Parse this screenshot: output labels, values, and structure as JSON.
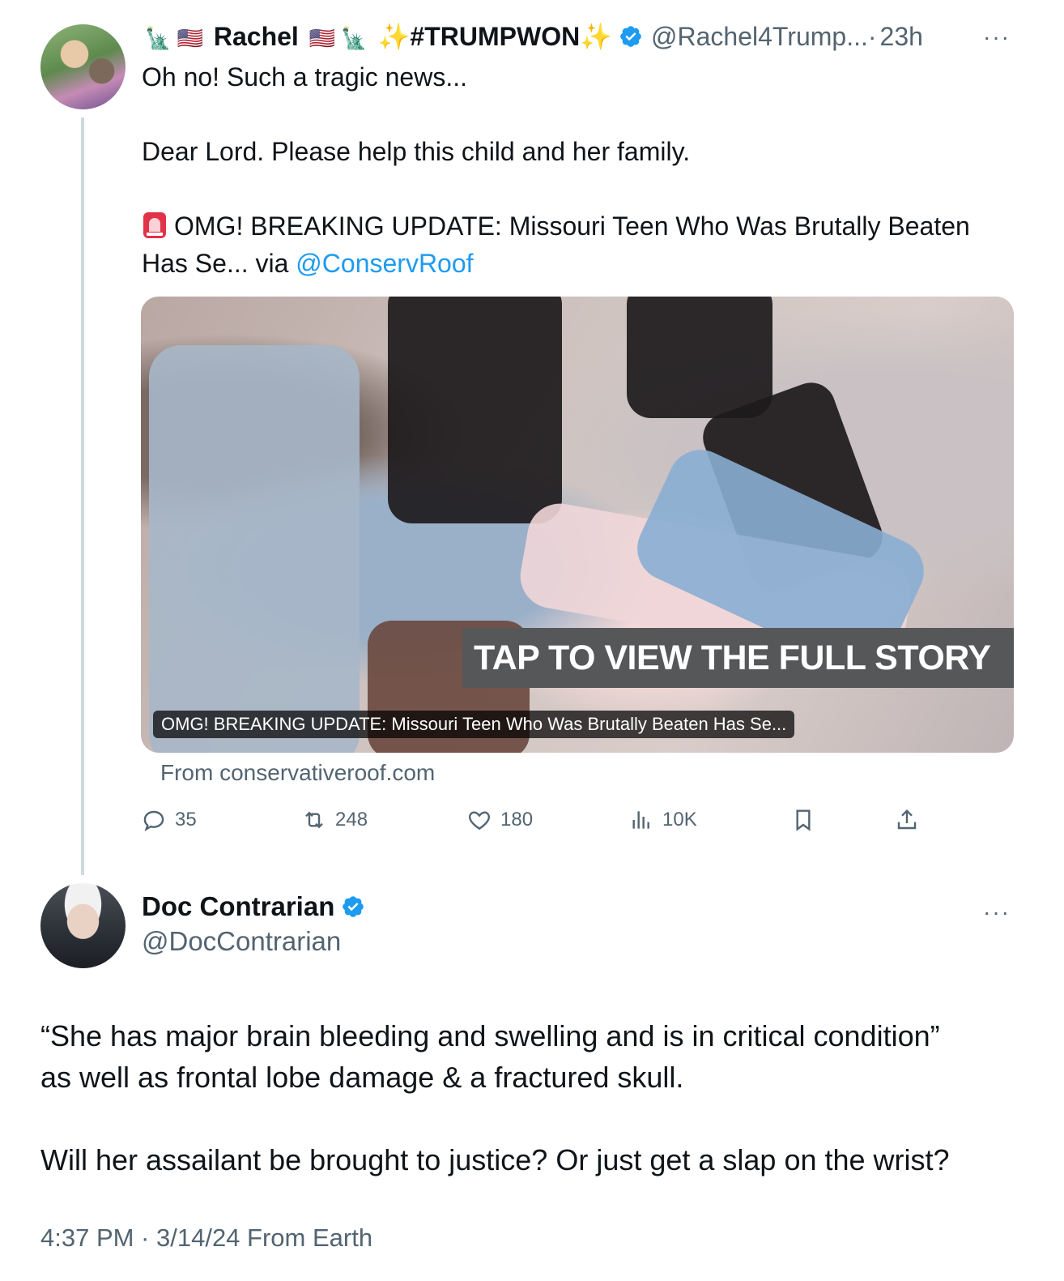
{
  "tweet1": {
    "name_prefix_emojis": "🗽 🇺🇸",
    "name": "Rachel",
    "name_suffix_emojis": "🇺🇸 🗽",
    "hashtag": "✨#TRUMPWON✨",
    "handle": "@Rachel4Trump...",
    "separator": "·",
    "time": "23h",
    "more": "···",
    "line1": "Oh no! Such a tragic news...",
    "line2": "Dear Lord. Please help this child and her family.",
    "line3": "OMG! BREAKING UPDATE: Missouri Teen Who Was Brutally Beaten",
    "line4_prefix": "Has Se... via ",
    "mention": "@ConservRoof",
    "card": {
      "banner": "TAP TO VIEW THE FULL STORY",
      "caption": "OMG! BREAKING UPDATE: Missouri Teen Who Was Brutally Beaten Has Se...",
      "source": "From conservativeroof.com"
    },
    "actions": {
      "replies": "35",
      "retweets": "248",
      "likes": "180",
      "views": "10K"
    },
    "icons": [
      "reply-icon",
      "retweet-icon",
      "like-icon",
      "views-icon",
      "bookmark-icon",
      "share-icon"
    ]
  },
  "tweet2": {
    "name": "Doc Contrarian",
    "handle": "@DocContrarian",
    "more": "···",
    "para1_line1": "“She has major brain bleeding and swelling and is in critical condition”",
    "para1_line2": "as well as frontal lobe damage & a fractured skull.",
    "para2": "Will her assailant be brought to justice? Or just get a slap on the wrist?",
    "meta": "4:37 PM · 3/14/24 From Earth"
  },
  "colors": {
    "text": "#0f1419",
    "secondary": "#536471",
    "link": "#1d9bf0",
    "verified": "#1d9bf0",
    "thread_line": "#cfd9de"
  }
}
